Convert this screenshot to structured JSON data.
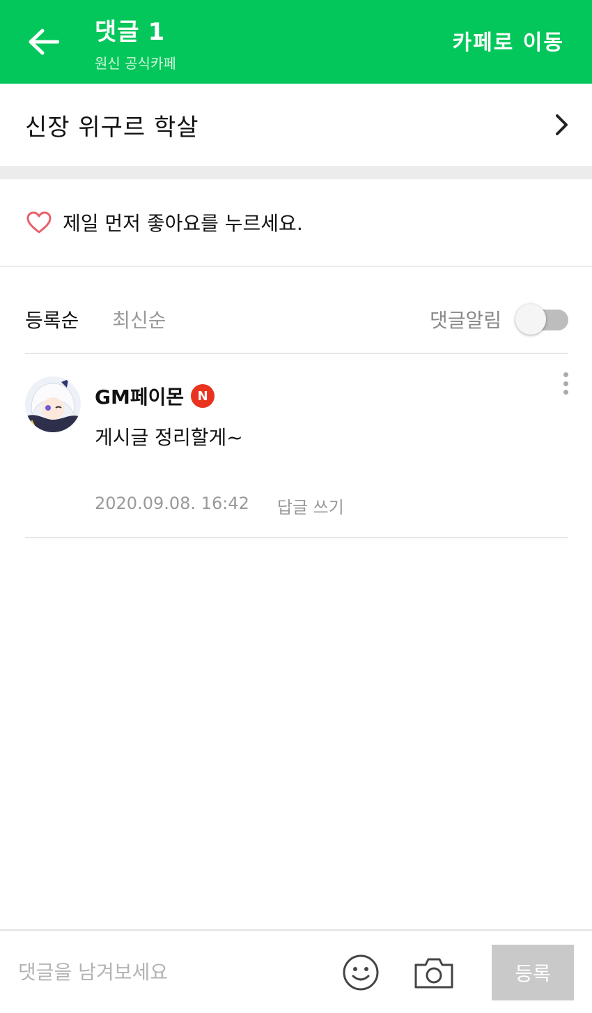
{
  "header": {
    "title": "댓글",
    "comment_count": "1",
    "subtitle": "원신 공식카페",
    "cafe_link": "카페로 이동",
    "back_icon": "back-arrow-icon"
  },
  "post": {
    "title": "신장 위구르 학살",
    "chevron_icon": "chevron-right-icon"
  },
  "like": {
    "text": "제일 먼저 좋아요를 누르세요.",
    "icon": "heart-outline-icon",
    "heart_color": "#e8606a"
  },
  "sort": {
    "tabs": [
      {
        "label": "등록순",
        "active": true
      },
      {
        "label": "최신순",
        "active": false
      }
    ],
    "alarm_label": "댓글알림",
    "alarm_on": false
  },
  "comments": [
    {
      "author": "GM페이몬",
      "badge": "N",
      "text": "게시글 정리할게~",
      "timestamp": "2020.09.08. 16:42",
      "reply_label": "답글 쓰기"
    }
  ],
  "composer": {
    "placeholder": "댓글을 남겨보세요",
    "emoji_icon": "smiley-icon",
    "camera_icon": "camera-icon",
    "submit_label": "등록"
  },
  "colors": {
    "brand": "#03c75a",
    "badge": "#e8331f",
    "submit_disabled": "#c9c9c9"
  }
}
